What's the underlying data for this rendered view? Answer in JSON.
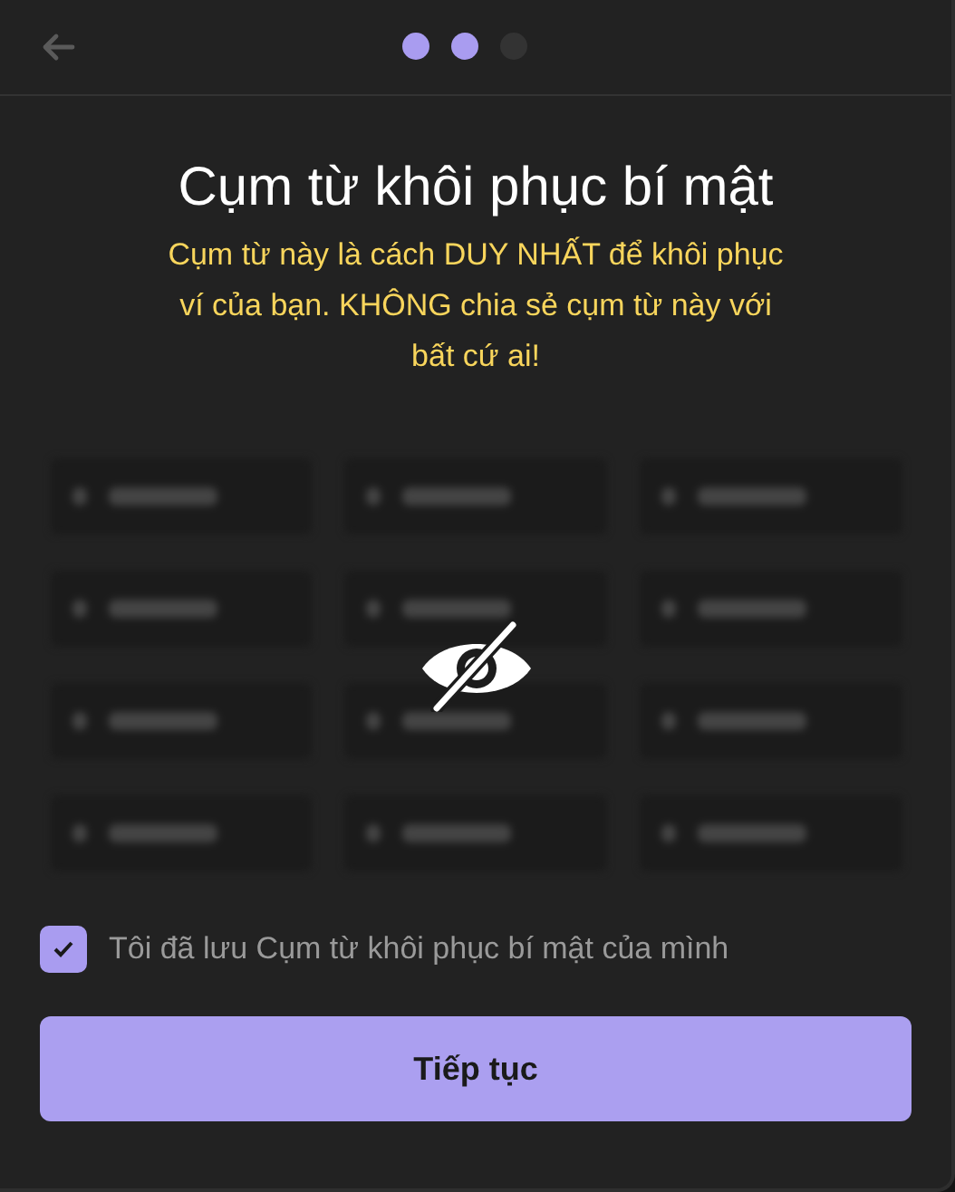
{
  "header": {
    "steps": [
      {
        "done": true
      },
      {
        "done": true
      },
      {
        "done": false
      }
    ]
  },
  "title": "Cụm từ khôi phục bí mật",
  "warning": "Cụm từ này là cách DUY NHẤT để khôi phục ví của bạn. KHÔNG chia sẻ cụm từ này với bất cứ ai!",
  "phrase_grid": {
    "hidden": true,
    "cells": [
      {
        "hidden": true
      },
      {
        "hidden": true
      },
      {
        "hidden": true
      },
      {
        "hidden": true
      },
      {
        "hidden": true
      },
      {
        "hidden": true
      },
      {
        "hidden": true
      },
      {
        "hidden": true
      },
      {
        "hidden": true
      },
      {
        "hidden": true
      },
      {
        "hidden": true
      },
      {
        "hidden": true
      }
    ]
  },
  "confirm": {
    "label": "Tôi đã lưu Cụm từ khôi phục bí mật của mình",
    "checked": true
  },
  "button": {
    "label": "Tiếp tục",
    "disabled": false
  }
}
